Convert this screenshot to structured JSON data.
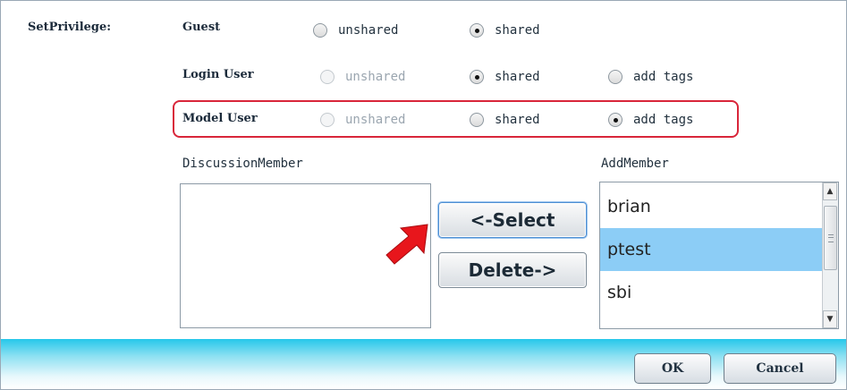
{
  "privilege": {
    "title": "SetPrivilege:",
    "rows": [
      {
        "role": "Guest",
        "options": [
          {
            "label": "unshared",
            "state": "off"
          },
          {
            "label": "shared",
            "state": "on"
          }
        ]
      },
      {
        "role": "Login User",
        "options": [
          {
            "label": "unshared",
            "state": "disabled"
          },
          {
            "label": "shared",
            "state": "on"
          },
          {
            "label": "add tags",
            "state": "off"
          }
        ]
      },
      {
        "role": "Model User",
        "options": [
          {
            "label": "unshared",
            "state": "disabled"
          },
          {
            "label": "shared",
            "state": "off"
          },
          {
            "label": "add tags",
            "state": "on"
          }
        ]
      }
    ]
  },
  "discussion": {
    "label": "DiscussionMember",
    "items": []
  },
  "add": {
    "label": "AddMember",
    "items": [
      "brian",
      "ptest",
      "sbi"
    ],
    "selected": "ptest"
  },
  "buttons": {
    "select": "<-Select",
    "delete": "Delete->",
    "ok": "OK",
    "cancel": "Cancel"
  },
  "colors": {
    "accent_highlight": "#d9263a",
    "selection": "#8ccdf6",
    "footer": "#25c7ea",
    "arrow": "#e8161c"
  },
  "icons": {
    "pointer": "red-arrow-icon",
    "scroll_up": "scroll-up-icon",
    "scroll_down": "scroll-down-icon"
  }
}
